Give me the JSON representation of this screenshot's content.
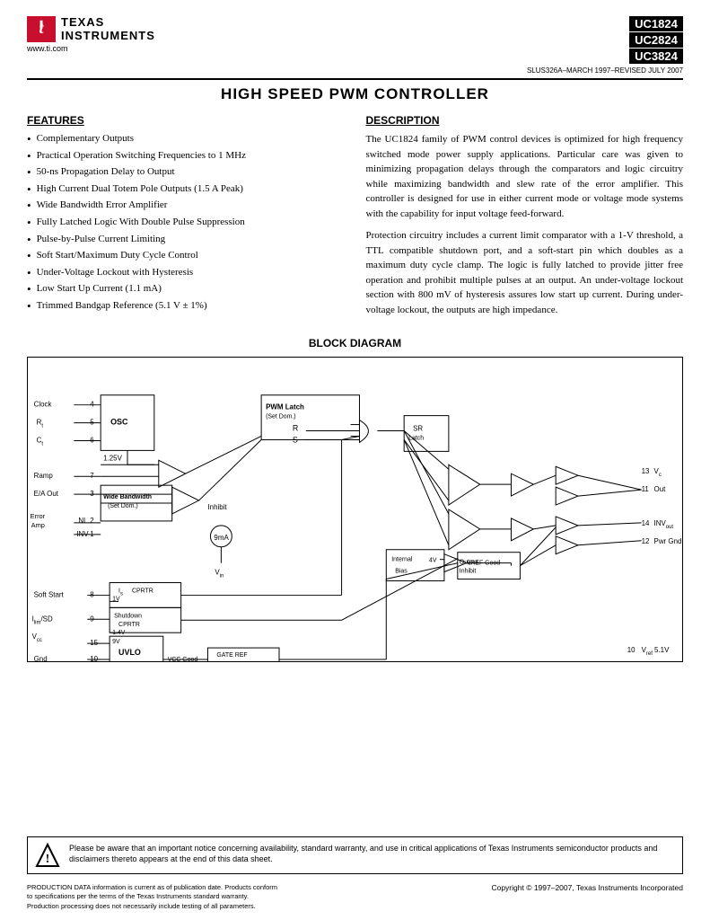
{
  "header": {
    "website": "www.ti.com",
    "doc_info": "SLUS326A–MARCH 1997–REVISED JULY 2007",
    "part_numbers": [
      "UC1824",
      "UC2824",
      "UC3824"
    ]
  },
  "title": "HIGH SPEED PWM CONTROLLER",
  "features": {
    "section_title": "FEATURES",
    "items": [
      "Complementary Outputs",
      "Practical Operation Switching Frequencies to 1 MHz",
      "50-ns Propagation Delay to Output",
      "High Current Dual Totem Pole Outputs (1.5 A Peak)",
      "Wide Bandwidth Error Amplifier",
      "Fully Latched Logic With Double Pulse Suppression",
      "Pulse-by-Pulse Current Limiting",
      "Soft Start/Maximum Duty Cycle Control",
      "Under-Voltage Lockout with Hysteresis",
      "Low Start Up Current (1.1 mA)",
      "Trimmed Bandgap Reference (5.1 V ± 1%)"
    ]
  },
  "description": {
    "section_title": "DESCRIPTION",
    "paragraphs": [
      "The UC1824 family of PWM control devices is optimized for high frequency switched mode power supply applications. Particular care was given to minimizing propagation delays through the comparators and logic circuitry while maximizing bandwidth and slew rate of the error amplifier. This controller is designed for use in either current mode or voltage mode systems with the capability for input voltage feed-forward.",
      "Protection circuitry includes a current limit comparator with a 1-V threshold, a TTL compatible shutdown port, and a soft-start pin which doubles as a maximum duty cycle clamp. The logic is fully latched to provide jitter free operation and prohibit multiple pulses at an output. An under-voltage lockout section with 800 mV of hysteresis assures low start up current. During under-voltage lockout, the outputs are high impedance."
    ]
  },
  "block_diagram": {
    "title": "BLOCK DIAGRAM"
  },
  "footer": {
    "warning_text": "Please be aware that an important notice concerning availability, standard warranty, and use in critical applications of Texas Instruments semiconductor products and disclaimers thereto appears at the end of this data sheet.",
    "production_text": "PRODUCTION DATA information is current as of publication date. Products conform to specifications per the terms of the Texas Instruments standard warranty. Production processing does not necessarily include testing of all parameters.",
    "copyright": "Copyright © 1997–2007, Texas Instruments Incorporated"
  }
}
